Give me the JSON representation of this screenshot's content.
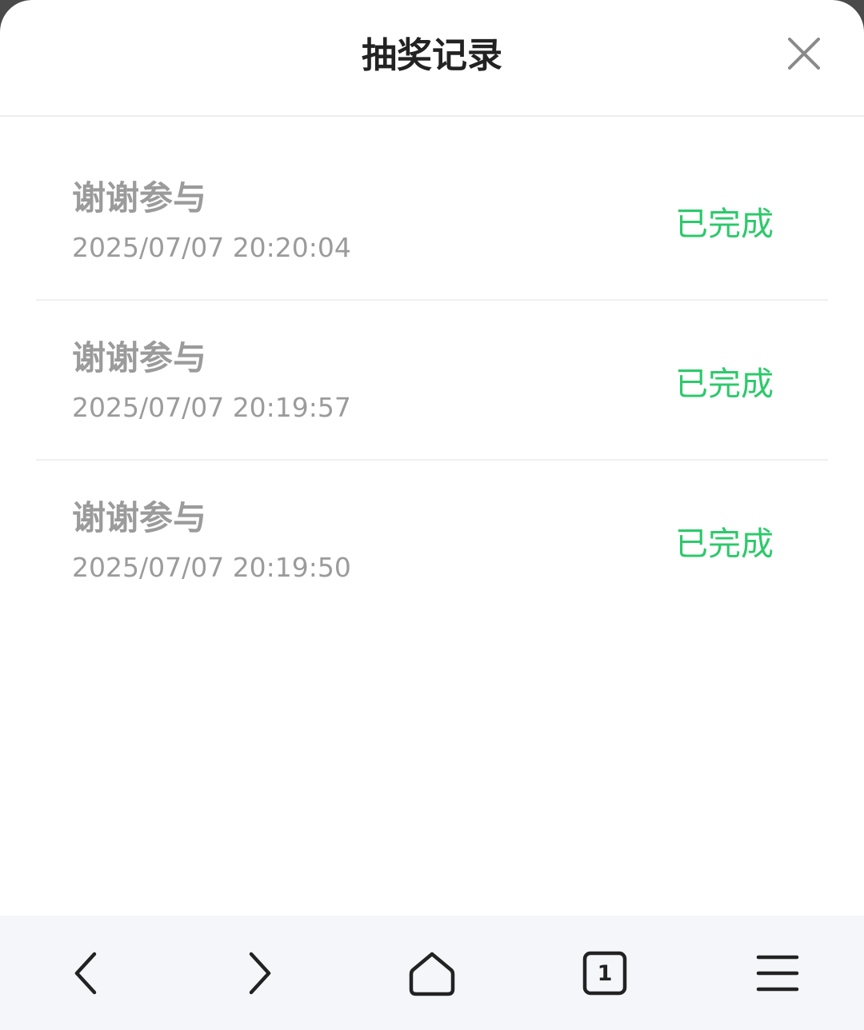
{
  "dialog": {
    "title": "抽奖记录",
    "close_icon": "close-icon"
  },
  "records": [
    {
      "name": "谢谢参与",
      "time": "2025/07/07 20:20:04",
      "status": "已完成"
    },
    {
      "name": "谢谢参与",
      "time": "2025/07/07 20:19:57",
      "status": "已完成"
    },
    {
      "name": "谢谢参与",
      "time": "2025/07/07 20:19:50",
      "status": "已完成"
    }
  ],
  "browser_nav": {
    "back_icon": "chevron-left-icon",
    "forward_icon": "chevron-right-icon",
    "home_icon": "home-icon",
    "tabs_icon": "tabs-icon",
    "tab_count": "1",
    "menu_icon": "menu-icon"
  },
  "colors": {
    "status_done": "#2dc96b",
    "muted_text": "#9b9b9b",
    "title_text": "#222222",
    "nav_bg": "#f4f6fa"
  }
}
